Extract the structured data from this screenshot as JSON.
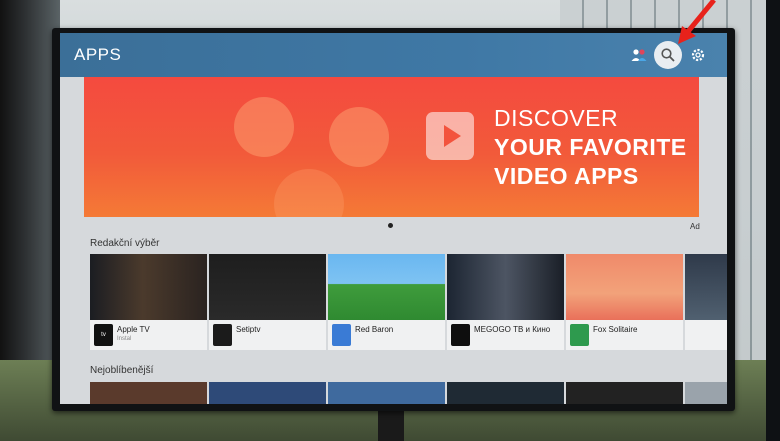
{
  "header": {
    "title": "APPS"
  },
  "banner": {
    "line1": "DISCOVER",
    "line2": "YOUR FAVORITE",
    "line3": "VIDEO APPS",
    "ad_label": "Ad"
  },
  "sections": [
    {
      "title": "Redakční výběr"
    },
    {
      "title": "Nejoblíbenější"
    }
  ],
  "apps": [
    {
      "name": "Apple TV",
      "sub": "Instal",
      "icon": "apple-tv-icon",
      "color": "#111111"
    },
    {
      "name": "Setiptv",
      "sub": "",
      "icon": "setiptv-icon",
      "color": "#1b1b1b"
    },
    {
      "name": "Red Baron",
      "sub": "",
      "icon": "red-baron-icon",
      "color": "#3a7bd5"
    },
    {
      "name": "MEGOGO ТВ и Кино",
      "sub": "",
      "icon": "megogo-icon",
      "color": "#0e0e0e"
    },
    {
      "name": "Fox Solitaire",
      "sub": "",
      "icon": "fox-solitaire-icon",
      "color": "#2e9a4e"
    }
  ],
  "colors": {
    "topbar": "#3f78a5",
    "banner": "#f25a3a",
    "arrow": "#e8221b"
  }
}
